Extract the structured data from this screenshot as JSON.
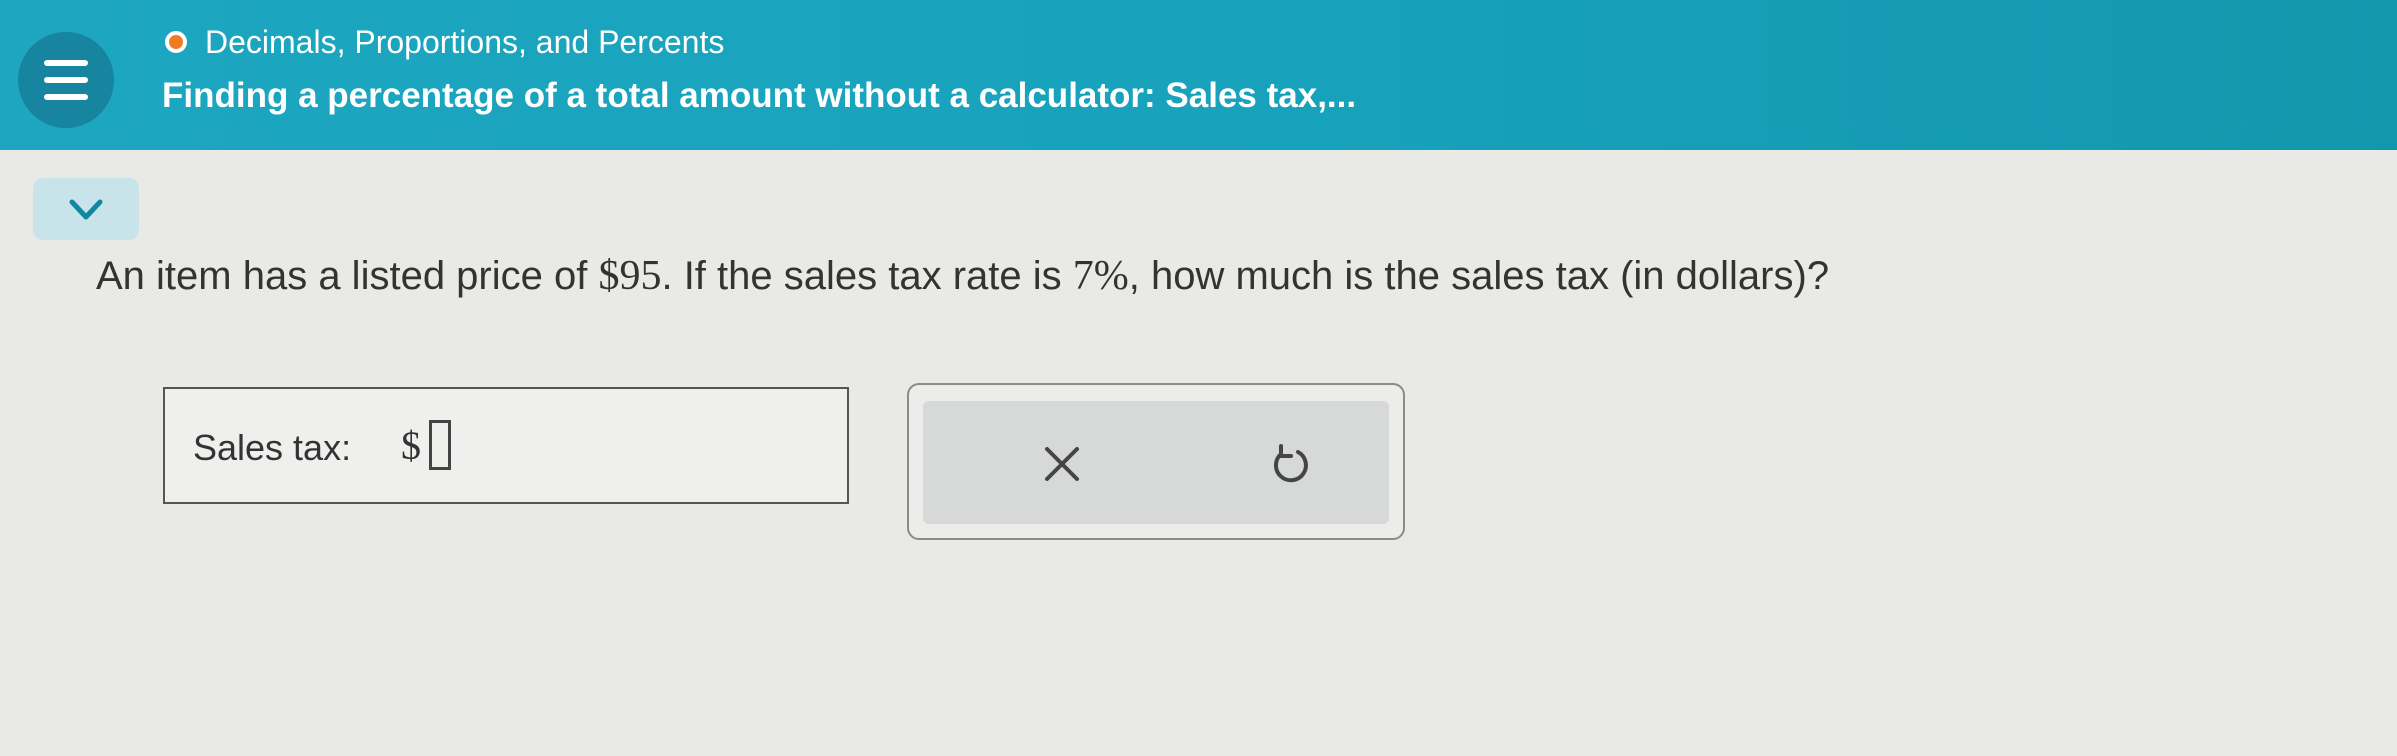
{
  "header": {
    "topic": "Decimals, Proportions, and Percents",
    "title": "Finding a percentage of a total amount without a calculator: Sales tax,..."
  },
  "question": {
    "intro": "An item has a listed price of ",
    "price": "$95",
    "middle": ". If the sales tax rate is ",
    "rate": "7%",
    "end": ", how much is the sales tax (in dollars)?"
  },
  "answer": {
    "label": "Sales tax:",
    "currency": "$",
    "value": ""
  },
  "icons": {
    "menu": "hamburger-menu-icon",
    "topic_status": "status-dot-icon",
    "collapse": "chevron-down-icon",
    "clear": "close-icon",
    "undo": "undo-icon"
  },
  "colors": {
    "header": "#1ea6c0",
    "topic_status": "#f07a1f"
  }
}
